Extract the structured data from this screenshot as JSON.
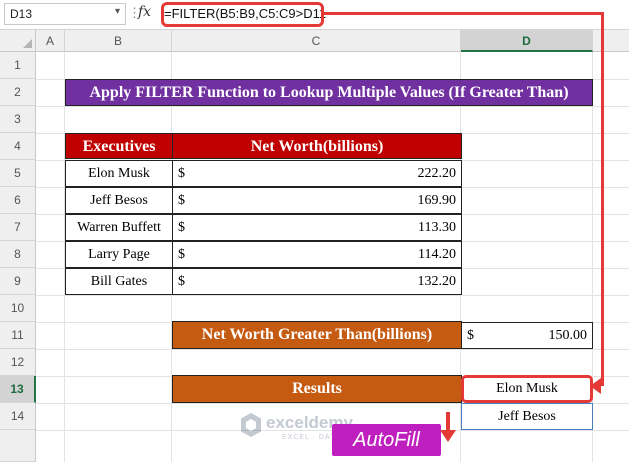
{
  "formula_bar": {
    "name_box": "D13",
    "fx_label": "fx",
    "formula": "=FILTER(B5:B9,C5:C9>D11"
  },
  "columns": [
    "A",
    "B",
    "C",
    "D"
  ],
  "rows": [
    "1",
    "2",
    "3",
    "4",
    "5",
    "6",
    "7",
    "8",
    "9",
    "10",
    "11",
    "12",
    "13",
    "14"
  ],
  "title": "Apply FILTER Function to Lookup Multiple Values (If Greater Than)",
  "table": {
    "headers": [
      "Executives",
      "Net Worth(billions)"
    ],
    "rows": [
      {
        "name": "Elon Musk",
        "currency": "$",
        "value": "222.20"
      },
      {
        "name": "Jeff Besos",
        "currency": "$",
        "value": "169.90"
      },
      {
        "name": "Warren Buffett",
        "currency": "$",
        "value": "113.30"
      },
      {
        "name": "Larry Page",
        "currency": "$",
        "value": "114.20"
      },
      {
        "name": "Bill Gates",
        "currency": "$",
        "value": "132.20"
      }
    ]
  },
  "criteria": {
    "label": "Net Worth Greater Than(billions)",
    "currency": "$",
    "value": "150.00"
  },
  "results": {
    "label": "Results",
    "values": [
      "Elon Musk",
      "Jeff Besos"
    ]
  },
  "watermark": {
    "name": "exceldemy",
    "tagline": "EXCEL · DATA · BI"
  },
  "autofill_label": "AutoFill",
  "colors": {
    "title_bg": "#7030a0",
    "header_bg": "#c00000",
    "orange_bg": "#c55a11",
    "highlight": "#e53935",
    "autofill_bg": "#c01fc0"
  }
}
